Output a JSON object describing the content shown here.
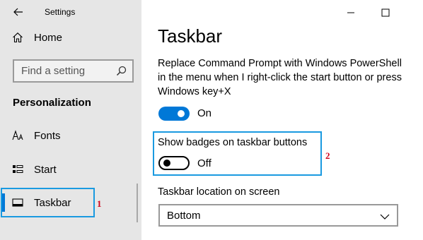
{
  "window": {
    "title": "Settings"
  },
  "sidebar": {
    "home_label": "Home",
    "search_placeholder": "Find a setting",
    "section_title": "Personalization",
    "items": [
      {
        "label": "Fonts",
        "icon": "fonts-icon"
      },
      {
        "label": "Start",
        "icon": "start-icon"
      },
      {
        "label": "Taskbar",
        "icon": "taskbar-icon",
        "selected": true
      }
    ]
  },
  "main": {
    "title": "Taskbar",
    "powershell_setting": {
      "description": "Replace Command Prompt with Windows PowerShell in the menu when I right-click the start button or press Windows key+X",
      "state_label": "On",
      "on": true
    },
    "badges_setting": {
      "label": "Show badges on taskbar buttons",
      "state_label": "Off",
      "on": false
    },
    "location_setting": {
      "label": "Taskbar location on screen",
      "selected": "Bottom"
    }
  },
  "annotations": {
    "marker_1": "1",
    "marker_2": "2"
  },
  "colors": {
    "accent": "#0078d7",
    "highlight": "#1a9ae0",
    "marker": "#d0021b",
    "sidebar_bg": "#e6e6e6"
  }
}
